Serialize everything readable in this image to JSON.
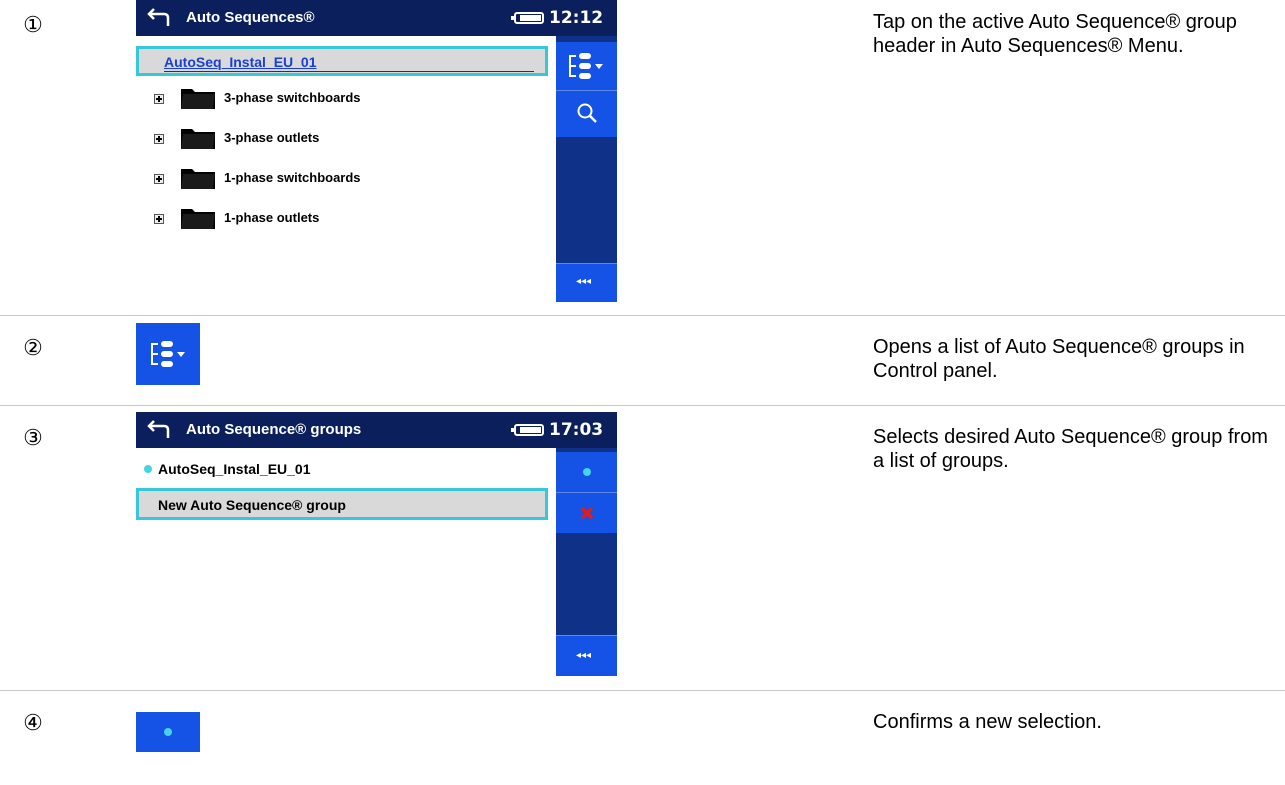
{
  "steps": [
    {
      "num": "①",
      "description": "Tap on the active Auto Sequence® group header in Auto Sequences® Menu."
    },
    {
      "num": "②",
      "description": "Opens a list of Auto Sequence® groups in Control panel."
    },
    {
      "num": "③",
      "description": "Selects desired Auto Sequence® group from a list of groups."
    },
    {
      "num": "④",
      "description": "Confirms a new selection."
    }
  ],
  "screen1": {
    "title": "Auto Sequences®",
    "time": "12:12",
    "active_group": "AutoSeq_Instal_EU_01",
    "folders": [
      "3-phase switchboards",
      "3-phase outlets",
      "1-phase switchboards",
      "1-phase outlets"
    ],
    "more_label": "◂◂◂"
  },
  "screen2": {
    "title": "Auto Sequence® groups",
    "time": "17:03",
    "groups": [
      "AutoSeq_Instal_EU_01",
      "New Auto Sequence® group"
    ],
    "more_label": "◂◂◂"
  },
  "icons": {
    "group_list": "group-list-icon",
    "search": "search-icon",
    "confirm": "dot-icon",
    "delete": "x-icon"
  },
  "colors": {
    "title_bar": "#0a1f5c",
    "panel": "#0f3288",
    "button": "#1453e6",
    "highlight": "#36c8d8",
    "delete": "#e31b1b"
  }
}
